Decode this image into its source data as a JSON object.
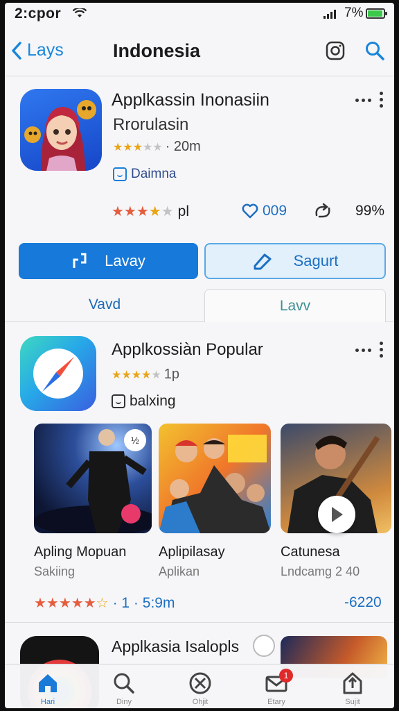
{
  "status_bar": {
    "time": "2:cpor",
    "battery": "7%"
  },
  "nav": {
    "back_label": "Lays",
    "title": "Indonesia"
  },
  "app1": {
    "title": "Applkassin Inonasiin",
    "subtitle": "Rrorulasin",
    "rating_text": "· 20m",
    "rating_stars": 3,
    "developer": "Daimna",
    "stats": {
      "rating_suffix": "pl",
      "likes": "009",
      "share_pct": "99%"
    }
  },
  "buttons": {
    "primary": "Lavay",
    "secondary": "Sagurt"
  },
  "tabs": {
    "left": "Vavd",
    "right": "Lavv"
  },
  "app2": {
    "title": "Applkossiàn Popular",
    "rating_text": "1p",
    "rating_stars": 4,
    "developer": "balxing"
  },
  "carousel": [
    {
      "title": "Apling Mopuan",
      "subtitle": "Sakiing",
      "badge": "½"
    },
    {
      "title": "Aplipilasay",
      "subtitle": "Aplikan"
    },
    {
      "title": "Catunesa",
      "subtitle": "Lndcamg 2 40"
    }
  ],
  "carousel_footer": {
    "rating_text": "· 1 · 5:9m",
    "count": "-6220"
  },
  "app3": {
    "title": "Applkasia Isalopls"
  },
  "tabbar": {
    "items": [
      {
        "label": "Hari",
        "icon": "home-icon"
      },
      {
        "label": "Diny",
        "icon": "search-icon"
      },
      {
        "label": "Ohjit",
        "icon": "x-circle-icon"
      },
      {
        "label": "Etary",
        "icon": "mail-icon",
        "badge": "1"
      },
      {
        "label": "Sujit",
        "icon": "share-icon"
      }
    ]
  },
  "colors": {
    "accent": "#1779d9",
    "star": "#e9a516",
    "badge": "#e02a2a"
  }
}
